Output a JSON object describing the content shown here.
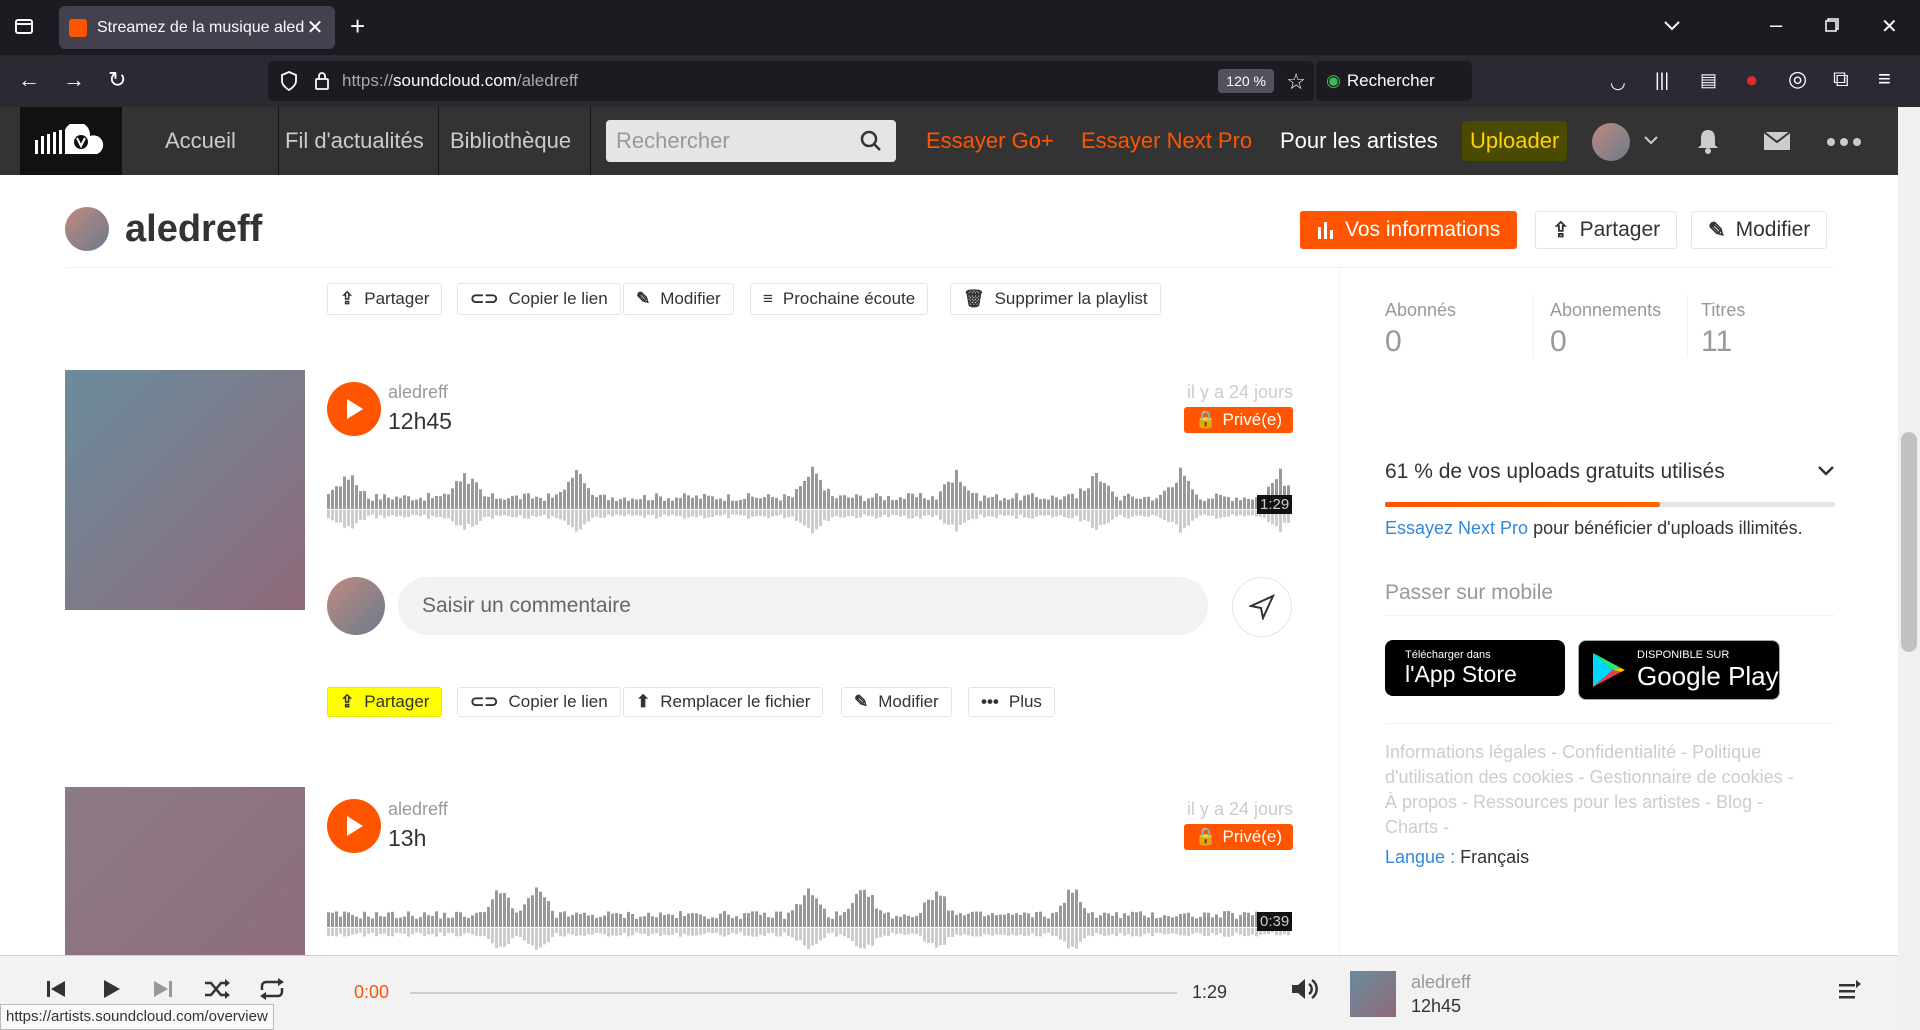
{
  "browser": {
    "tab_title": "Streamez de la musique aledreff",
    "url_proto": "https://",
    "url_host": "soundcloud.com",
    "url_path": "/aledreff",
    "zoom": "120 %",
    "search_placeholder": "Rechercher",
    "status_url": "https://artists.soundcloud.com/overview"
  },
  "header": {
    "nav": [
      "Accueil",
      "Fil d'actualités",
      "Bibliothèque"
    ],
    "search_placeholder": "Rechercher",
    "go_plus": "Essayer Go+",
    "next_pro": "Essayer Next Pro",
    "artists": "Pour les artistes",
    "upload": "Uploader"
  },
  "profile": {
    "name": "aledreff",
    "insights": "Vos informations",
    "share": "Partager",
    "edit": "Modifier"
  },
  "playlist_actions": [
    "Partager",
    "Copier le lien",
    "Modifier",
    "Prochaine écoute",
    "Supprimer la playlist"
  ],
  "tracks": [
    {
      "user": "aledreff",
      "title": "12h45",
      "date": "il y a 24 jours",
      "privacy": "Privé(e)",
      "duration": "1:29"
    },
    {
      "user": "aledreff",
      "title": "13h",
      "date": "il y a 24 jours",
      "privacy": "Privé(e)",
      "duration": "0:39"
    }
  ],
  "comment_placeholder": "Saisir un commentaire",
  "track_actions": [
    "Partager",
    "Copier le lien",
    "Remplacer le fichier",
    "Modifier",
    "Plus"
  ],
  "sidebar": {
    "stats": [
      {
        "label": "Abonnés",
        "value": "0"
      },
      {
        "label": "Abonnements",
        "value": "0"
      },
      {
        "label": "Titres",
        "value": "11"
      }
    ],
    "uploads_text": "61 % de vos uploads gratuits utilisés",
    "uploads_used": 0.61,
    "next_pro_link": "Essayez Next Pro",
    "next_pro_rest": " pour bénéficier d'uploads illimités.",
    "mobile": "Passer sur mobile",
    "appstore_small": "Télécharger dans",
    "appstore_big": "l'App Store",
    "google_small": "DISPONIBLE SUR",
    "google_big": "Google Play",
    "footer_l1": "Informations légales - Confidentialité - Politique",
    "footer_l2": "d'utilisation des cookies - Gestionnaire de cookies -",
    "footer_l3": "À propos - Ressources pour les artistes - Blog -",
    "footer_l4": "Charts -",
    "lang_label": "Langue :",
    "lang_value": "Français"
  },
  "player": {
    "elapsed": "0:00",
    "total": "1:29",
    "user": "aledreff",
    "title": "12h45"
  },
  "colors": {
    "accent": "#ff5500",
    "highlight": "#ffff00"
  }
}
